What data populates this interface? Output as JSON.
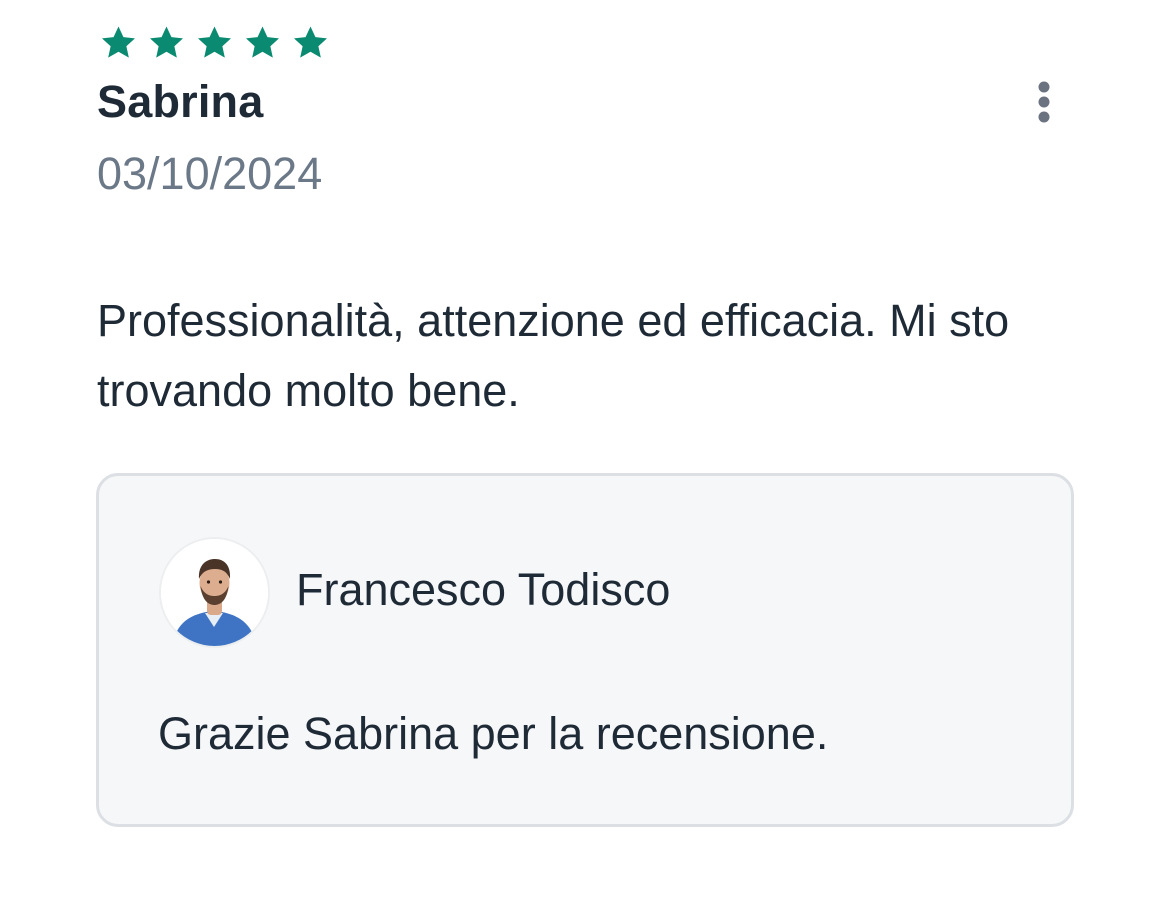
{
  "review": {
    "rating": 5,
    "rating_max": 5,
    "star_color": "#0a8a70",
    "reviewer_name": "Sabrina",
    "date": "03/10/2024",
    "text": "Professionalità, attenzione ed efficacia. Mi sto trovando molto bene.",
    "more_icon": "more-vertical-icon"
  },
  "reply": {
    "doctor_name": "Francesco Todisco",
    "avatar_icon": "doctor-avatar",
    "text": "Grazie Sabrina per la recensione."
  },
  "colors": {
    "text_primary": "#1f2a37",
    "text_secondary": "#6b7888",
    "card_background": "#f6f7f9",
    "card_border": "#dcdfe3",
    "icon_gray": "#6b7280"
  }
}
